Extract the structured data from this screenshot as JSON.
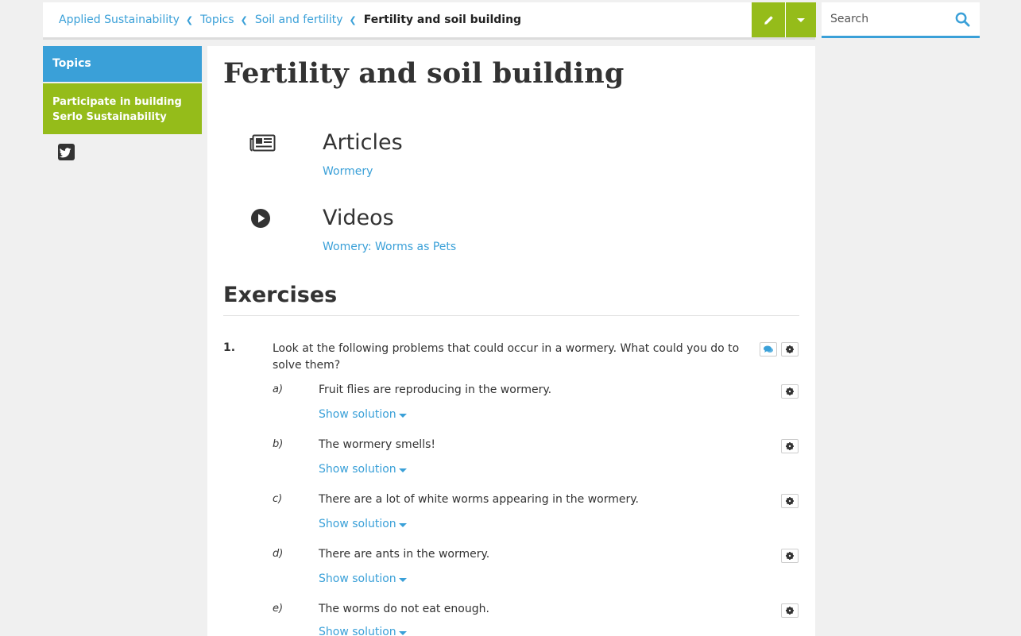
{
  "breadcrumb": {
    "items": [
      "Applied Sustainability",
      "Topics",
      "Soil and fertility"
    ],
    "current": "Fertility and soil building"
  },
  "search": {
    "placeholder": "Search"
  },
  "sidebar": {
    "topics": "Topics",
    "participate": "Participate in building Serlo Sustainability"
  },
  "page": {
    "title": "Fertility and soil building"
  },
  "sections": {
    "articles": {
      "title": "Articles",
      "link": "Wormery"
    },
    "videos": {
      "title": "Videos",
      "link": "Womery: Worms as Pets"
    }
  },
  "exercises": {
    "heading": "Exercises",
    "number": "1.",
    "text": "Look at the following problems that could occur in a wormery. What could you do to solve them?",
    "show_solution": "Show solution",
    "subs": [
      {
        "label": "a)",
        "text": "Fruit flies are reproducing in the wormery."
      },
      {
        "label": "b)",
        "text": "The wormery smells!"
      },
      {
        "label": "c)",
        "text": "There are a lot of white worms appearing in the wormery."
      },
      {
        "label": "d)",
        "text": "There are ants in the wormery."
      },
      {
        "label": "e)",
        "text": "The worms do not eat enough."
      }
    ]
  },
  "colors": {
    "blue": "#3aa0d8",
    "green": "#95bc1a"
  }
}
